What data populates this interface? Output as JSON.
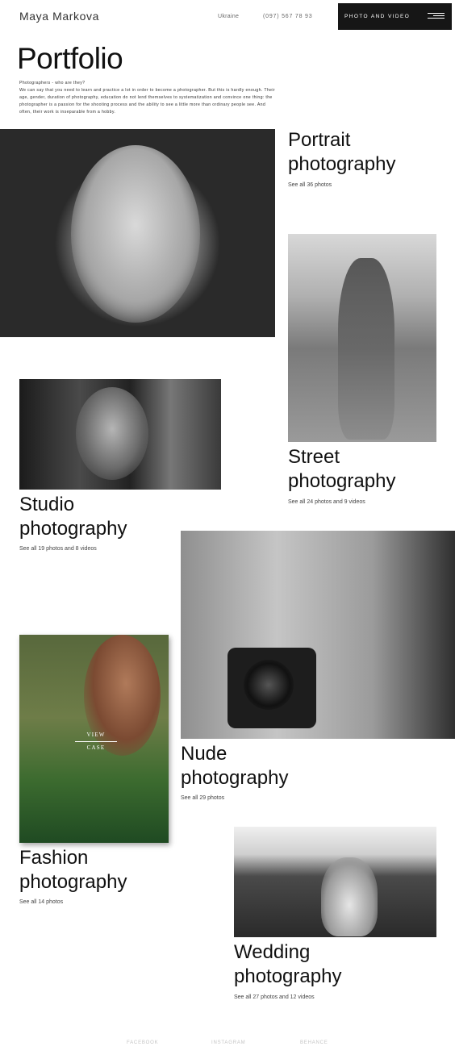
{
  "header": {
    "brand": "Maya  Markova",
    "country": "Ukraine",
    "phone": "(097)  567  78  93",
    "menu_label": "PHOTO  AND  VIDEO"
  },
  "page": {
    "title": "Portfolio",
    "intro": "Photographers - who are they?\nWe can say that you need to learn and practice a lot in order to become a photographer. But this is hardly enough. Their age, gender, duration of photography, education do not lend themselves to systematization and convince one thing: the photographer is a passion for the shooting process and the ability to see a little more than ordinary people see. And often, their work is inseparable from a hobby."
  },
  "categories": [
    {
      "title_line1": "Portrait",
      "title_line2": "photography",
      "link": "See all 36 photos"
    },
    {
      "title_line1": "Street",
      "title_line2": "photography",
      "link": "See all 24 photos and 9 videos"
    },
    {
      "title_line1": "Studio",
      "title_line2": "photography",
      "link": "See all 19 photos and 8 videos"
    },
    {
      "title_line1": "Nude",
      "title_line2": "photography",
      "link": "See all 29 photos"
    },
    {
      "title_line1": "Fashion",
      "title_line2": "photography",
      "link": "See all 14 photos"
    },
    {
      "title_line1": "Wedding",
      "title_line2": "photography",
      "link": "See all 27 photos and 12 videos"
    }
  ],
  "overlay": {
    "view": "VIEW",
    "case": "CASE"
  },
  "footer": {
    "facebook": "FACEBOOK",
    "instagram": "INSTAGRAM",
    "behance": "BEHANCE"
  },
  "colors": {
    "background": "#ffffff",
    "menu_button": "#161616",
    "text": "#111111",
    "footer_links": "#c4c4c4"
  },
  "icons": [
    "hamburger-menu-icon"
  ]
}
